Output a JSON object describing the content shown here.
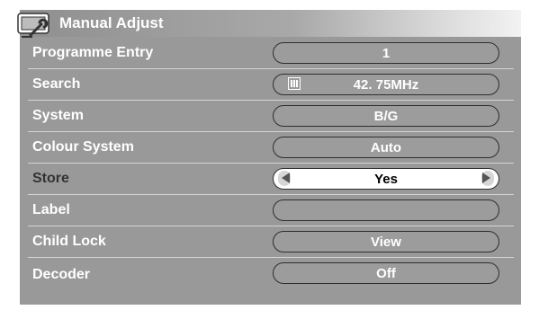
{
  "header": {
    "title": "Manual Adjust",
    "icon": "tv-wrench-icon"
  },
  "rows": [
    {
      "label": "Programme Entry",
      "value": "1",
      "label_color": "#ffffff",
      "selected": false
    },
    {
      "label": "Search",
      "value": "42. 75MHz",
      "value_icon": "band-icon",
      "label_color": "#ffffff",
      "selected": false
    },
    {
      "label": "System",
      "value": "B/G",
      "label_color": "#ffffff",
      "selected": false
    },
    {
      "label": "Colour System",
      "value": "Auto",
      "label_color": "#ffffff",
      "selected": false
    },
    {
      "label": "Store",
      "value": "Yes",
      "label_color": "#333333",
      "selected": true
    },
    {
      "label": "Label",
      "value": "",
      "label_color": "#ffffff",
      "selected": false
    },
    {
      "label": "Child Lock",
      "value": "View",
      "label_color": "#ffffff",
      "selected": false
    },
    {
      "label": "Decoder",
      "value": "Off",
      "label_color": "#ffffff",
      "selected": false
    }
  ],
  "colors": {
    "panel_bg": "#999999",
    "selected_pill_bg": "#ffffff"
  }
}
